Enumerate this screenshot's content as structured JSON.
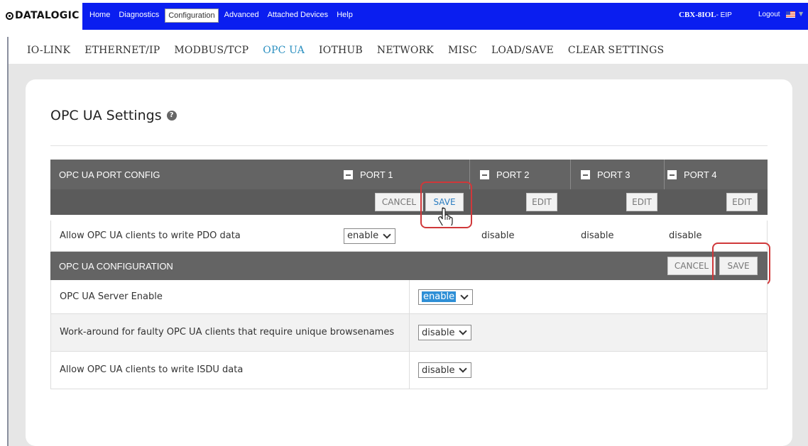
{
  "brand": {
    "logo_text": "DATALOGIC"
  },
  "top_nav": {
    "items": [
      {
        "label": "Home",
        "active": false
      },
      {
        "label": "Diagnostics",
        "active": false
      },
      {
        "label": "Configuration",
        "active": true
      },
      {
        "label": "Advanced",
        "active": false
      },
      {
        "label": "Attached Devices",
        "active": false
      },
      {
        "label": "Help",
        "active": false
      }
    ],
    "device_name": "CBX-8IOL",
    "device_suffix": "- EIP",
    "logout": "Logout",
    "bar_color": "#0a1ef0"
  },
  "sub_nav": {
    "items": [
      {
        "label": "IO-LINK",
        "active": false
      },
      {
        "label": "ETHERNET/IP",
        "active": false
      },
      {
        "label": "MODBUS/TCP",
        "active": false
      },
      {
        "label": "OPC UA",
        "active": true
      },
      {
        "label": "IOTHUB",
        "active": false
      },
      {
        "label": "NETWORK",
        "active": false
      },
      {
        "label": "MISC",
        "active": false
      },
      {
        "label": "LOAD/SAVE",
        "active": false
      },
      {
        "label": "CLEAR SETTINGS",
        "active": false
      }
    ],
    "active_color": "#2a8fc0"
  },
  "page": {
    "title": "OPC UA Settings"
  },
  "port_config": {
    "header": "OPC UA PORT CONFIG",
    "ports": [
      "PORT 1",
      "PORT 2",
      "PORT 3",
      "PORT 4"
    ],
    "buttons": {
      "cancel": "CANCEL",
      "save": "SAVE",
      "edit": "EDIT"
    },
    "row": {
      "label": "Allow OPC UA clients to write PDO data",
      "port1_value": "enable",
      "port2_value": "disable",
      "port3_value": "disable",
      "port4_value": "disable"
    }
  },
  "configuration": {
    "header": "OPC UA CONFIGURATION",
    "buttons": {
      "cancel": "CANCEL",
      "save": "SAVE"
    },
    "rows": [
      {
        "label": "OPC UA Server Enable",
        "value": "enable"
      },
      {
        "label": "Work-around for faulty OPC UA clients that require unique browsenames",
        "value": "disable"
      },
      {
        "label": "Allow OPC UA clients to write ISDU data",
        "value": "disable"
      }
    ]
  },
  "annotation_color": "#d0383a"
}
